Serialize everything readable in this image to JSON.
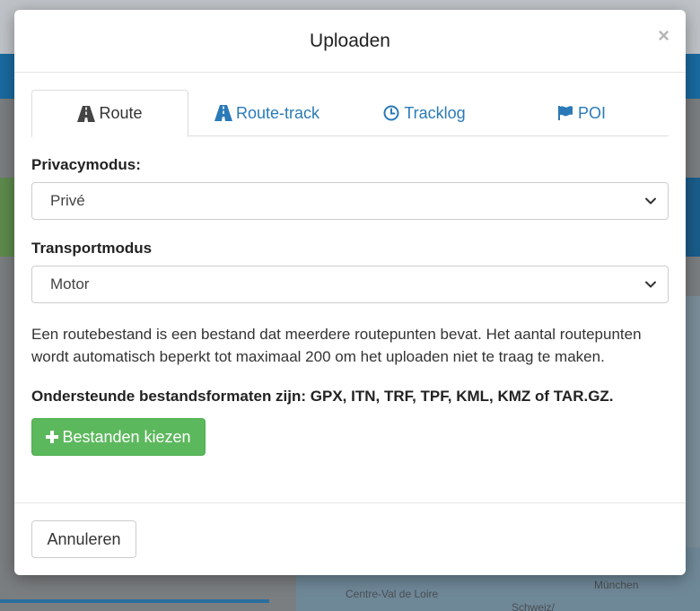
{
  "modal": {
    "title": "Uploaden",
    "close_symbol": "×",
    "tabs": [
      {
        "label": "Route",
        "icon": "road-icon",
        "active": true
      },
      {
        "label": "Route-track",
        "icon": "road-icon",
        "active": false
      },
      {
        "label": "Tracklog",
        "icon": "clock-icon",
        "active": false
      },
      {
        "label": "POI",
        "icon": "flag-icon",
        "active": false
      }
    ],
    "privacy": {
      "label": "Privacymodus:",
      "selected": "Privé"
    },
    "transport": {
      "label": "Transportmodus",
      "selected": "Motor"
    },
    "info_text": "Een routebestand is een bestand dat meerdere routepunten bevat. Het aantal routepunten wordt automatisch beperkt tot maximaal 200 om het uploaden niet te traag te maken.",
    "formats_text": "Ondersteunde bestandsformaten zijn: GPX, ITN, TRF, TPF, KML, KMZ of TAR.GZ.",
    "choose_button": "Bestanden kiezen",
    "cancel_button": "Annuleren"
  },
  "background": {
    "map_labels": [
      "Centre-Val de Loire",
      "München",
      "Schweiz/"
    ]
  },
  "colors": {
    "link_blue": "#2a7ab8",
    "success_green": "#5cb85c"
  }
}
